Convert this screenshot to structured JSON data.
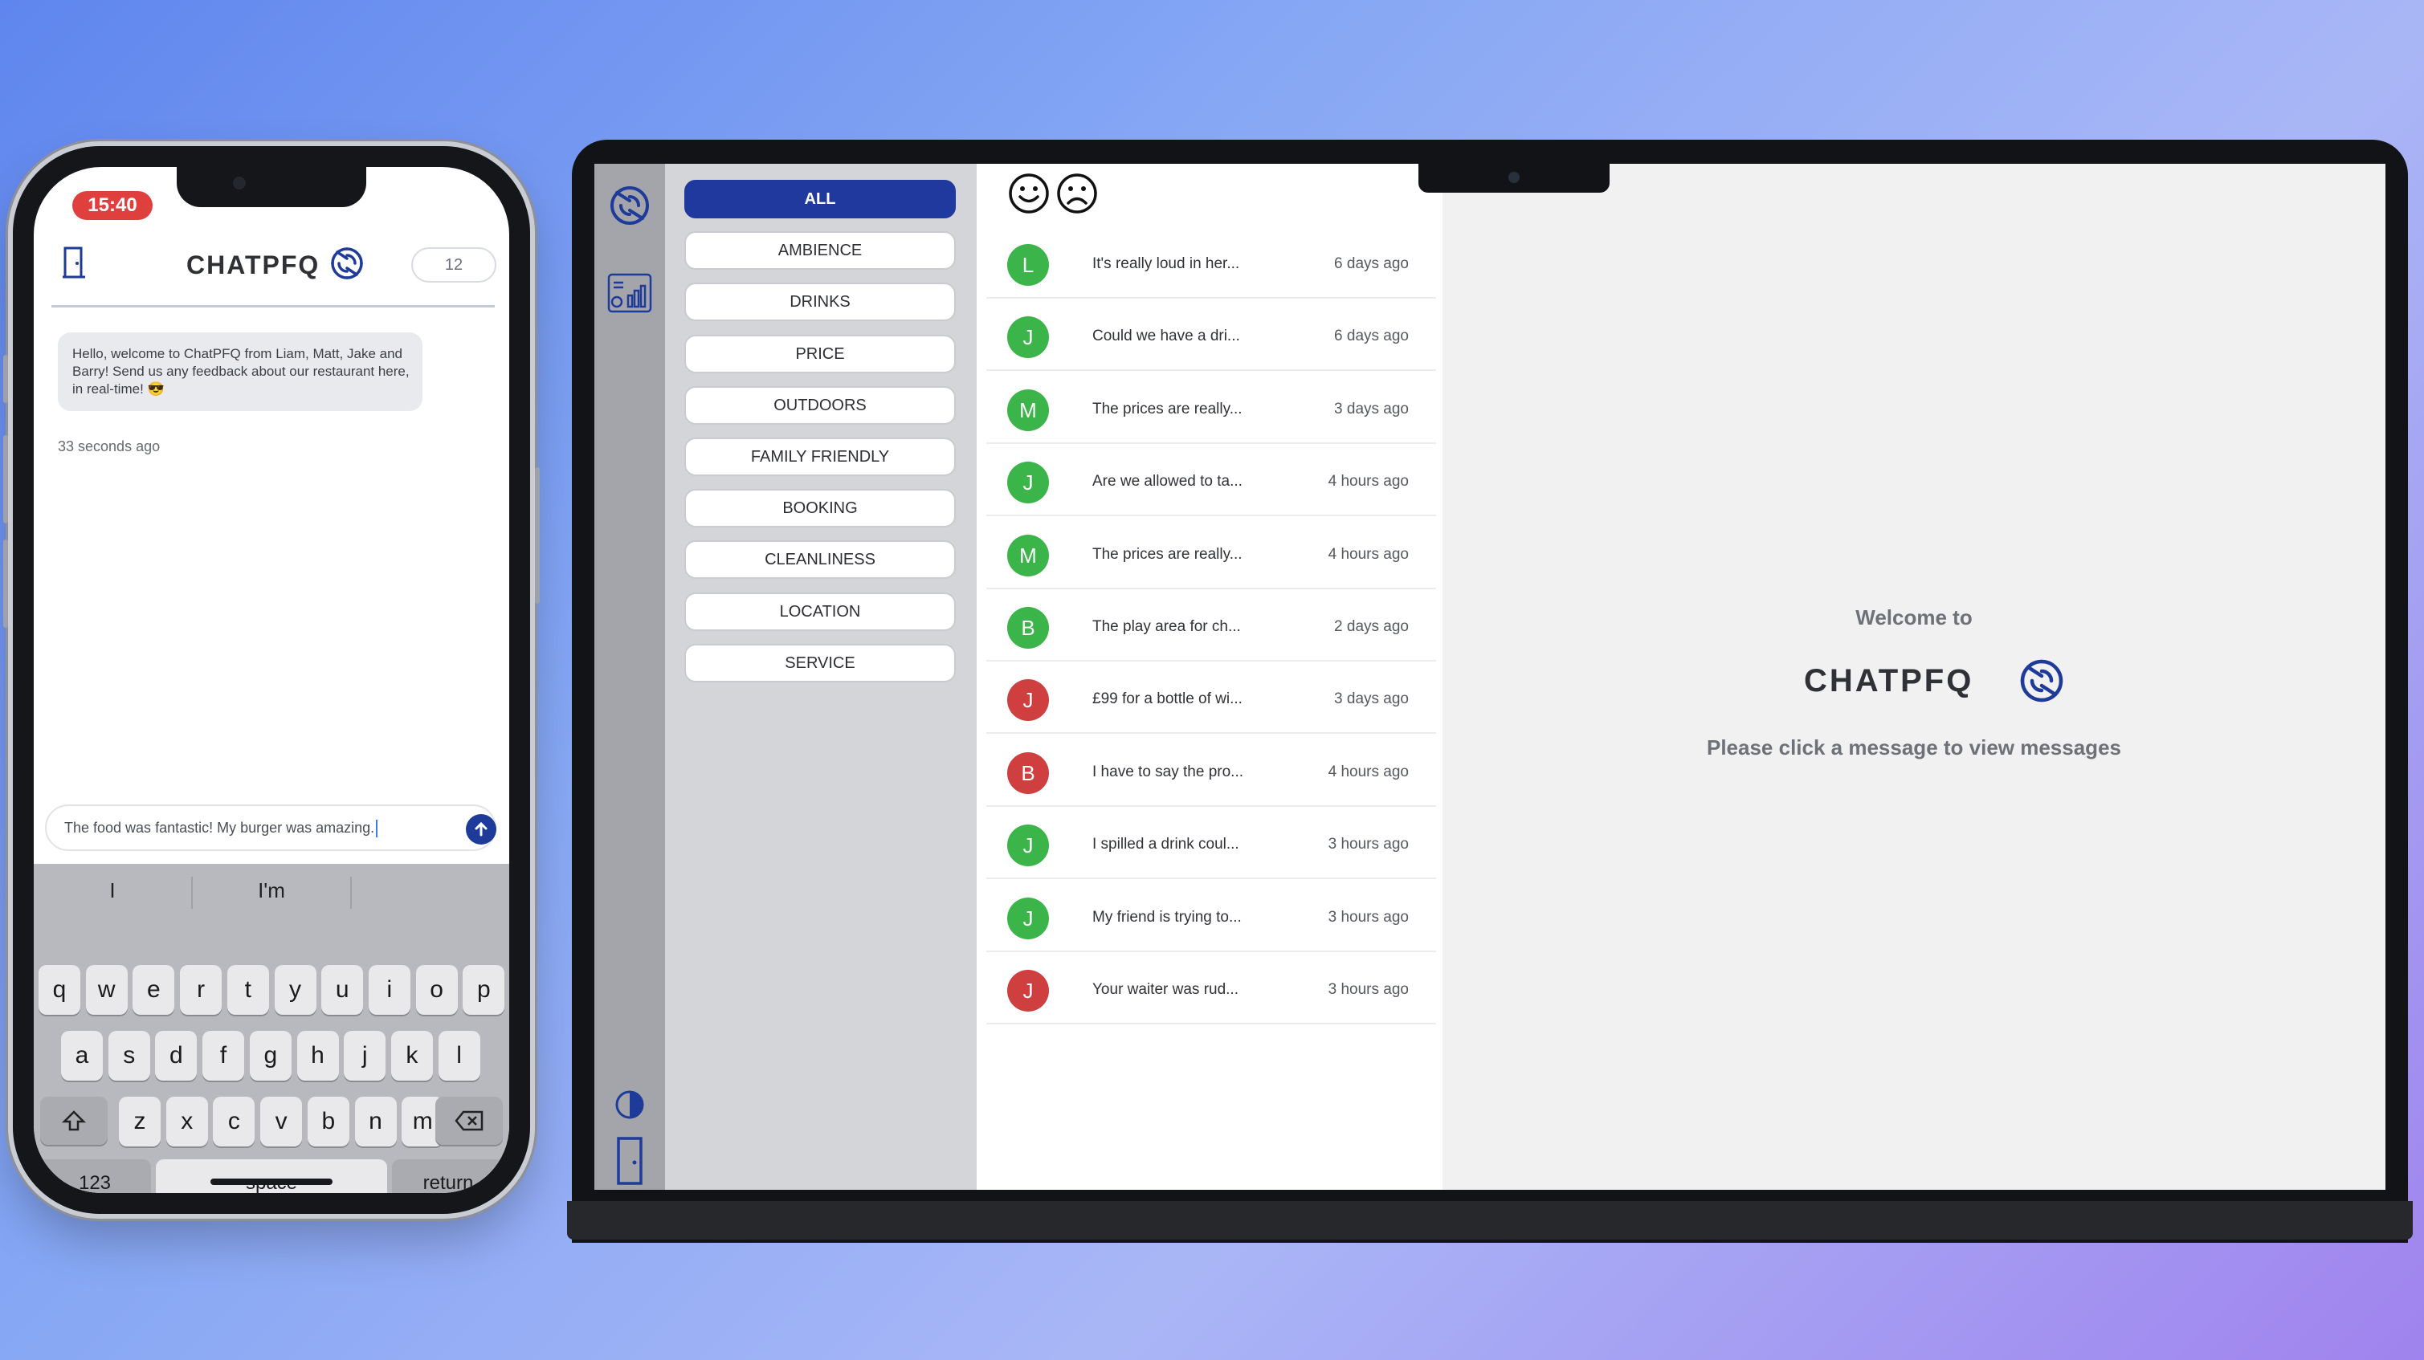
{
  "phone": {
    "status_time": "15:40",
    "brand": "CHATPFQ",
    "unread_count": "12",
    "welcome_message": "Hello, welcome to ChatPFQ from Liam, Matt, Jake and Barry! Send us any feedback about our restaurant here, in real-time! 😎",
    "welcome_time": "33 seconds ago",
    "input_value": "The food was fantastic! My burger was amazing.",
    "keyboard": {
      "suggestions": [
        "I",
        "I'm",
        ""
      ],
      "row1": [
        "q",
        "w",
        "e",
        "r",
        "t",
        "y",
        "u",
        "i",
        "o",
        "p"
      ],
      "row2": [
        "a",
        "s",
        "d",
        "f",
        "g",
        "h",
        "j",
        "k",
        "l"
      ],
      "row3": [
        "z",
        "x",
        "c",
        "v",
        "b",
        "n",
        "m"
      ],
      "numbers_label": "123",
      "space_label": "space",
      "return_label": "return"
    }
  },
  "dashboard": {
    "categories": [
      {
        "label": "ALL",
        "active": true
      },
      {
        "label": "AMBIENCE",
        "active": false
      },
      {
        "label": "DRINKS",
        "active": false
      },
      {
        "label": "PRICE",
        "active": false
      },
      {
        "label": "OUTDOORS",
        "active": false
      },
      {
        "label": "FAMILY FRIENDLY",
        "active": false
      },
      {
        "label": "BOOKING",
        "active": false
      },
      {
        "label": "CLEANLINESS",
        "active": false
      },
      {
        "label": "LOCATION",
        "active": false
      },
      {
        "label": "SERVICE",
        "active": false
      }
    ],
    "messages": [
      {
        "initial": "L",
        "sentiment": "positive",
        "preview": "It's really loud in her...",
        "time": "6 days ago"
      },
      {
        "initial": "J",
        "sentiment": "positive",
        "preview": "Could we have a dri...",
        "time": "6 days ago"
      },
      {
        "initial": "M",
        "sentiment": "positive",
        "preview": "The prices are really...",
        "time": "3 days ago"
      },
      {
        "initial": "J",
        "sentiment": "positive",
        "preview": "Are we allowed to ta...",
        "time": "4 hours ago"
      },
      {
        "initial": "M",
        "sentiment": "positive",
        "preview": "The prices are really...",
        "time": "4 hours ago"
      },
      {
        "initial": "B",
        "sentiment": "positive",
        "preview": "The play area for ch...",
        "time": "2 days ago"
      },
      {
        "initial": "J",
        "sentiment": "negative",
        "preview": "£99 for a bottle of wi...",
        "time": "3 days ago"
      },
      {
        "initial": "B",
        "sentiment": "negative",
        "preview": "I have to say the pro...",
        "time": "4 hours ago"
      },
      {
        "initial": "J",
        "sentiment": "positive",
        "preview": "I spilled a drink coul...",
        "time": "3 hours ago"
      },
      {
        "initial": "J",
        "sentiment": "positive",
        "preview": "My friend is trying to...",
        "time": "3 hours ago"
      },
      {
        "initial": "J",
        "sentiment": "negative",
        "preview": "Your waiter was rud...",
        "time": "3 hours ago"
      }
    ],
    "welcome": {
      "line1": "Welcome to",
      "brand": "CHATPFQ",
      "hint": "Please click a message to view messages"
    }
  },
  "colors": {
    "accent": "#20399e",
    "positive": "#3bb44a",
    "negative": "#cf3f3f",
    "status_time_bg": "#e0403d"
  },
  "icons": {
    "logo": "chatpfq-swirl-icon",
    "exit": "door-exit-icon",
    "send": "arrow-up-icon",
    "dashboard": "analytics-icon",
    "theme": "contrast-toggle-icon",
    "happy": "smiley-face-icon",
    "sad": "sad-face-icon"
  }
}
